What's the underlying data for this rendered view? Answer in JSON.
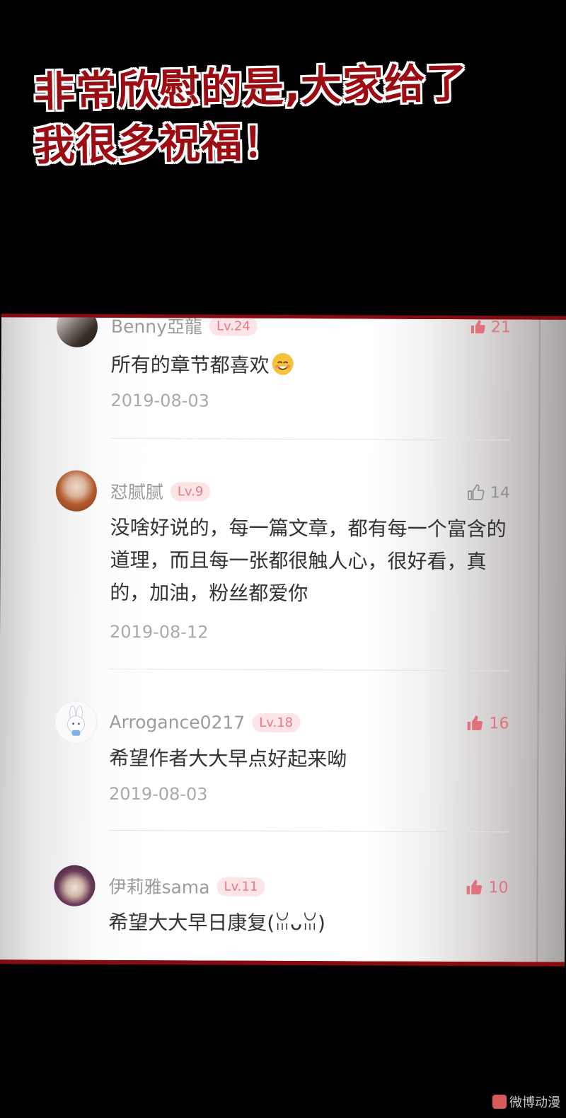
{
  "caption": {
    "line1": "非常欣慰的是,大家给了",
    "line2": "我很多祝福！"
  },
  "comments": [
    {
      "username": "Benny亞龍",
      "level": "Lv.24",
      "likes": "21",
      "text": "所有的章节都喜欢",
      "emoji": "smiling-face-emoji",
      "date": "2019-08-03"
    },
    {
      "username": "怼腻腻",
      "level": "Lv.9",
      "likes": "14",
      "text": "没啥好说的，每一篇文章，都有每一个富含的道理，而且每一张都很触人心，很好看，真的，加油，粉丝都爱你",
      "date": "2019-08-12"
    },
    {
      "username": "Arrogance0217",
      "level": "Lv.18",
      "likes": "16",
      "text": "希望作者大大早点好起来呦",
      "date": "2019-08-03"
    },
    {
      "username": "伊莉雅sama",
      "level": "Lv.11",
      "likes": "10",
      "text": "希望大大早日康复(ꈍᴗꈍ)"
    }
  ],
  "watermark": {
    "text": "微博动漫"
  },
  "colors": {
    "caption": "#9b0d12",
    "border": "#8a0b0f",
    "level_badge": "#fde4e7",
    "like_active": "#e0727e"
  }
}
